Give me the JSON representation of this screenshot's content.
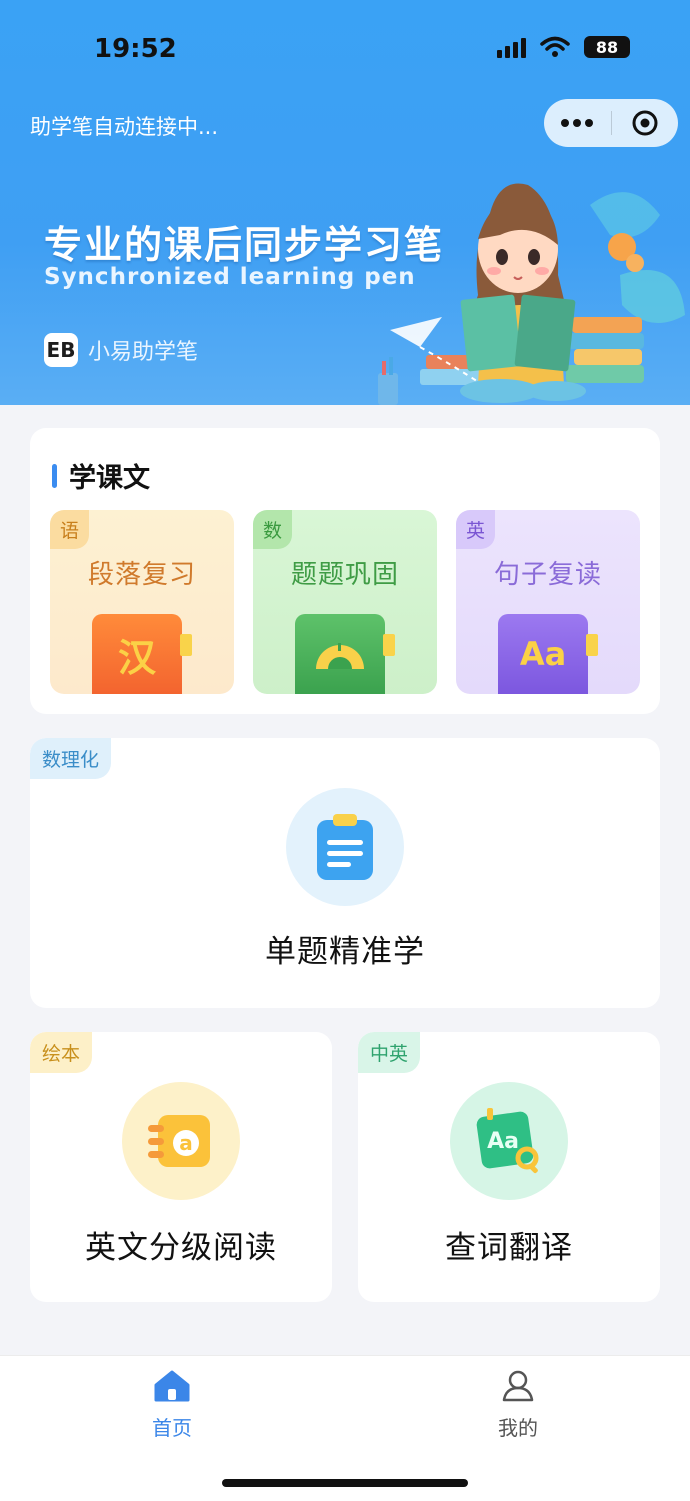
{
  "status_bar": {
    "time": "19:52",
    "battery": "88"
  },
  "mini_program": {
    "connection_status": "助学笔自动连接中..."
  },
  "banner": {
    "title": "专业的课后同步学习笔",
    "subtitle": "Synchronized learning pen",
    "brand_logo": "EB",
    "brand_name": "小易助学笔"
  },
  "learn_text": {
    "title": "学课文",
    "items": [
      {
        "tag": "语",
        "label": "段落复习",
        "icon_text": "汉",
        "color": "#f08a3a"
      },
      {
        "tag": "数",
        "label": "题题巩固",
        "color": "#3fb35a"
      },
      {
        "tag": "英",
        "label": "句子复读",
        "icon_text": "Aa",
        "color": "#8a63e6"
      }
    ]
  },
  "digital_card": {
    "tag": "数理化",
    "label": "单题精准学"
  },
  "picture_book_card": {
    "tag": "绘本",
    "label": "英文分级阅读",
    "icon_text": "a"
  },
  "translate_card": {
    "tag": "中英",
    "label": "查词翻译",
    "icon_text": "Aa"
  },
  "tabbar": {
    "items": [
      {
        "label": "首页",
        "active": true,
        "icon": "home-icon"
      },
      {
        "label": "我的",
        "active": false,
        "icon": "person-icon"
      }
    ],
    "active_color": "#3b86e8"
  }
}
